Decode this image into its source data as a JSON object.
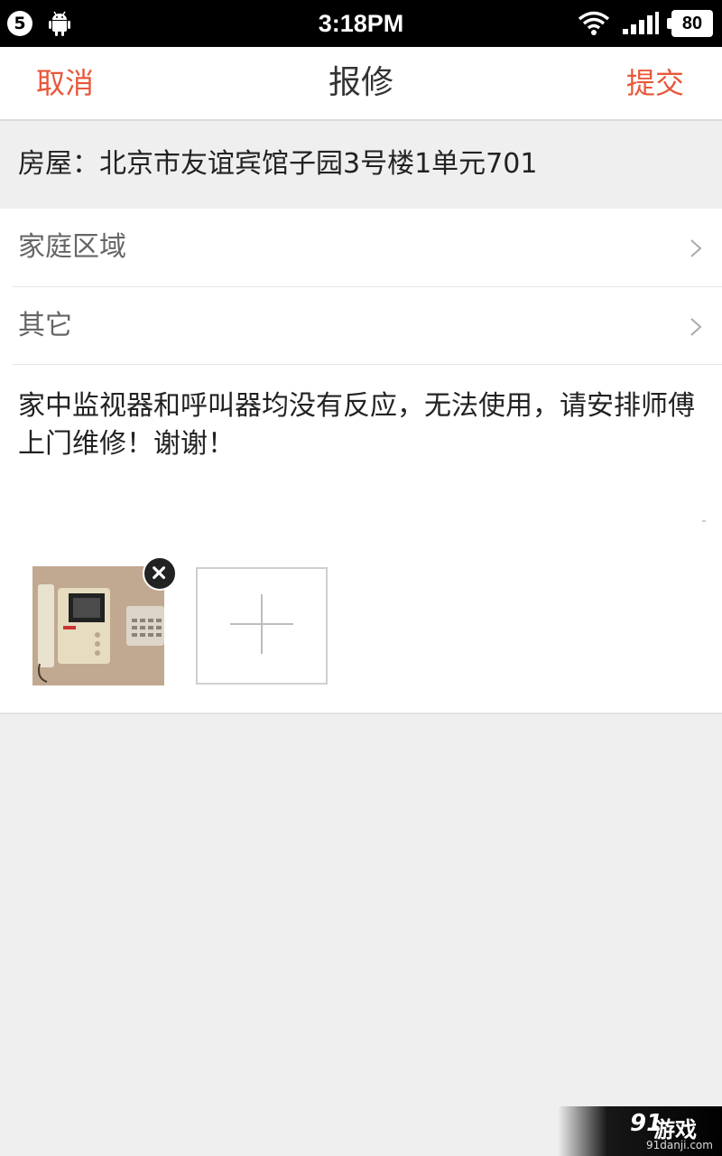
{
  "status_bar": {
    "notification_count": "5",
    "time": "3:18PM",
    "battery": "80"
  },
  "nav": {
    "cancel_label": "取消",
    "title": "报修",
    "submit_label": "提交"
  },
  "house": {
    "text": "房屋：北京市友谊宾馆子园3号楼1单元701"
  },
  "form": {
    "area_label": "家庭区域",
    "category_label": "其它",
    "description": "家中监视器和呼叫器均没有反应，无法使用，请安排师傅上门维修！谢谢！"
  },
  "attachments": {
    "photo_icon": "intercom-photo",
    "add_icon": "plus-icon",
    "remove_icon": "close-icon"
  },
  "watermark": {
    "logo": "91",
    "brand": "游戏",
    "url": "91danji.com"
  },
  "colors": {
    "accent": "#e8573a",
    "background": "#efefef"
  }
}
